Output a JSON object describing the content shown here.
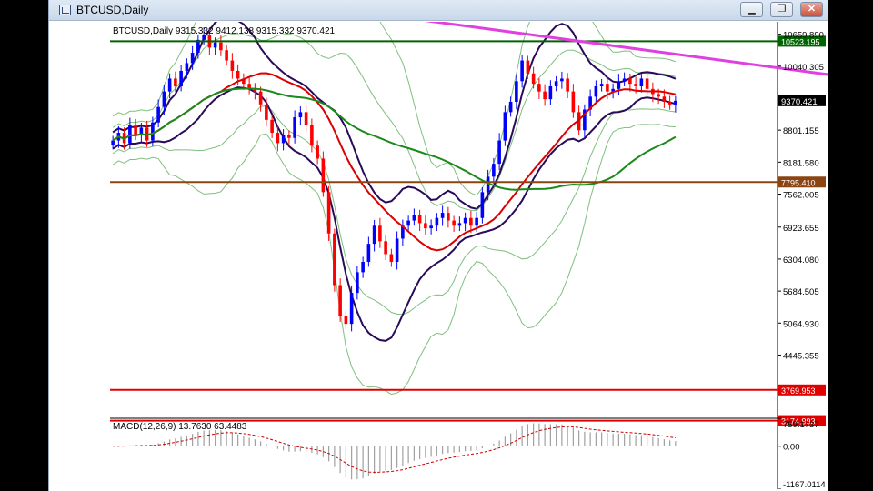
{
  "window": {
    "title": "BTCUSD,Daily",
    "buttons": {
      "minimize": "▁",
      "restore": "❐",
      "close": "✕"
    }
  },
  "chart_data": {
    "type": "candlestick",
    "symbol_line": "BTCUSD,Daily  9315.332 9412.138 9315.332 9370.421",
    "price_axis": {
      "ticks": [
        10659.89,
        10040.305,
        8801.155,
        8181.58,
        7562.005,
        6923.655,
        6304.08,
        5684.505,
        5064.93,
        4445.355
      ],
      "tick_labels": [
        "10659.890",
        "10040.305",
        "8801.155",
        "8181.580",
        "7562.005",
        "6923.655",
        "6304.080",
        "5684.505",
        "5064.930",
        "4445.355"
      ],
      "ylim": [
        3150,
        10900
      ]
    },
    "levels": [
      {
        "price": 10523.195,
        "label": "10523.195",
        "color": "#006400"
      },
      {
        "price": 7795.41,
        "label": "7795.410",
        "color": "#8b4513"
      },
      {
        "price": 3769.953,
        "label": "3769.953",
        "color": "#e00000"
      },
      {
        "price": 3174.993,
        "label": "3174.993",
        "color": "#e00000"
      }
    ],
    "current_price": {
      "price": 9370.421,
      "label": "9370.421"
    },
    "trendline": {
      "color": "#e040e0",
      "from": [
        0.29,
        11200
      ],
      "to": [
        1.0,
        9870
      ]
    },
    "indicator_colors": {
      "bull": "#0000ff",
      "bear": "#ff0000",
      "ma_fast": "#dd0000",
      "ma_slow": "#1a8a1a",
      "band_inner": "#2a0a5a",
      "band_outer": "#7fbf7f"
    },
    "series_close": [
      8600,
      8750,
      8550,
      8900,
      8700,
      8850,
      8600,
      8950,
      9250,
      9550,
      9800,
      9650,
      9950,
      10100,
      10300,
      10550,
      10650,
      10400,
      10500,
      10350,
      10150,
      9950,
      9800,
      9700,
      9600,
      9550,
      9300,
      9000,
      8750,
      8550,
      8700,
      8650,
      9050,
      9150,
      8900,
      8500,
      8250,
      7600,
      6800,
      5800,
      5200,
      5050,
      5650,
      6050,
      6250,
      6600,
      6950,
      6650,
      6400,
      6250,
      6700,
      6950,
      7050,
      7150,
      7000,
      6900,
      6950,
      7100,
      7200,
      7050,
      6950,
      7000,
      7100,
      6950,
      7100,
      7600,
      7900,
      8150,
      8600,
      9150,
      9350,
      9750,
      10150,
      9900,
      9700,
      9550,
      9400,
      9650,
      9750,
      9800,
      9550,
      9150,
      8800,
      9200,
      9450,
      9650,
      9700,
      9550,
      9600,
      9750,
      9800,
      9700,
      9650,
      9800,
      9600,
      9500,
      9450,
      9350,
      9300,
      9370.421
    ],
    "macd": {
      "label": "MACD(12,26,9) 13.7630 63.4483",
      "ticks": [
        759.1737,
        0.0,
        -1167.0114
      ],
      "tick_labels": [
        "759.1737",
        "0.00",
        "-1167.0114"
      ],
      "ylim": [
        -1167.0114,
        759.1737
      ],
      "hist_color": "#a0a0a0",
      "signal_color": "#cc0000"
    }
  }
}
